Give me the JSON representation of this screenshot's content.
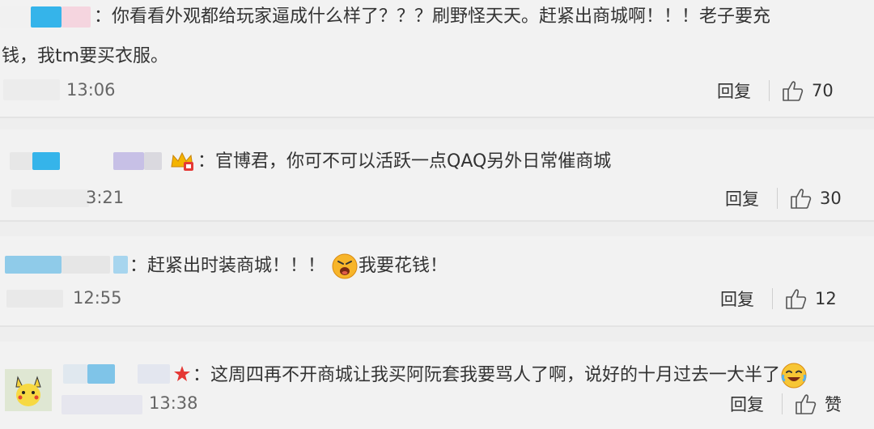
{
  "comments": [
    {
      "text": "：你看看外观都给玩家逼成什么样了？？？刷野怪天天。赶紧出商城啊！！！老子要充",
      "text2": "钱，我tm要买衣服。",
      "time": "13:06",
      "reply": "回复",
      "likes": "70"
    },
    {
      "text": "：官博君，你可不可以活跃一点QAQ另外日常催商城",
      "time": "3:21",
      "reply": "回复",
      "likes": "30"
    },
    {
      "text": "：赶紧出时装商城！！！",
      "text_after": "我要花钱！",
      "time": "12:55",
      "reply": "回复",
      "likes": "12"
    },
    {
      "text": "：这周四再不开商城让我买阿阮套我要骂人了啊，说好的十月过去一大半了",
      "time": "13:38",
      "reply": "回复",
      "likes": "赞"
    }
  ],
  "icons": {
    "thumb": "thumbs-up-icon",
    "crown": "crown-badge-icon",
    "angry": "angry-emoji-icon",
    "laugh": "laugh-cry-emoji-icon"
  },
  "colors": {
    "blue_blur": "#35b4ea",
    "pink_blur": "#f5d5df",
    "purple_blur": "#c7c0e6",
    "background": "#f2f2f2"
  }
}
